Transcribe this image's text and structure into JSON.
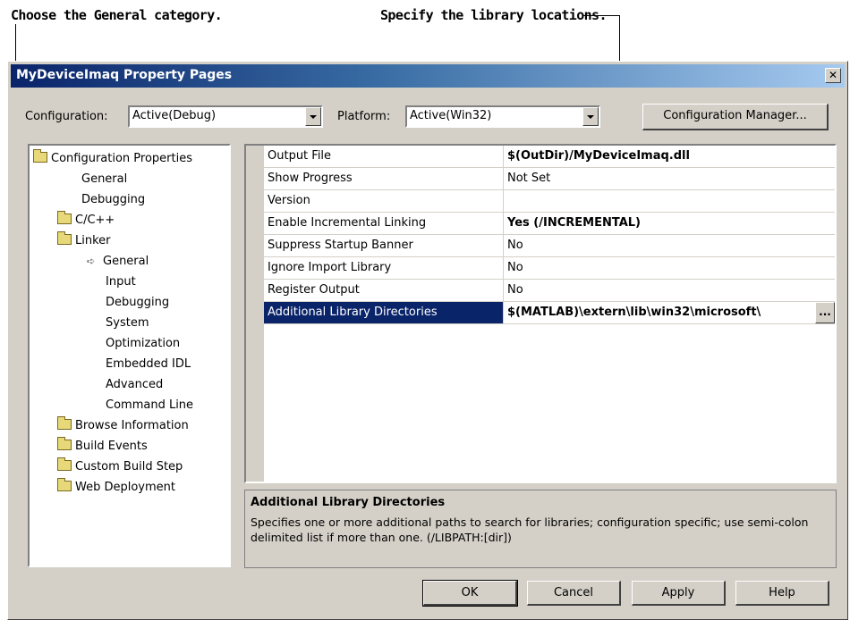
{
  "callouts": {
    "left": "Choose the General category.",
    "right": "Specify the library locations."
  },
  "window": {
    "title": "MyDeviceImaq Property Pages",
    "close_glyph": "✕"
  },
  "toolbar": {
    "configuration_label": "Configuration:",
    "configuration_value": "Active(Debug)",
    "platform_label": "Platform:",
    "platform_value": "Active(Win32)",
    "config_manager_label": "Configuration Manager..."
  },
  "tree": {
    "items": [
      {
        "label": "Configuration Properties",
        "icon": "folder-open-icon"
      },
      {
        "label": "General"
      },
      {
        "label": "Debugging"
      },
      {
        "label": "C/C++",
        "icon": "folder-icon"
      },
      {
        "label": "Linker",
        "icon": "folder-open-icon"
      },
      {
        "label": "General",
        "icon": "arrow-right-icon"
      },
      {
        "label": "Input"
      },
      {
        "label": "Debugging"
      },
      {
        "label": "System"
      },
      {
        "label": "Optimization"
      },
      {
        "label": "Embedded IDL"
      },
      {
        "label": "Advanced"
      },
      {
        "label": "Command Line"
      },
      {
        "label": "Browse Information",
        "icon": "folder-icon"
      },
      {
        "label": "Build Events",
        "icon": "folder-icon"
      },
      {
        "label": "Custom Build Step",
        "icon": "folder-icon"
      },
      {
        "label": "Web Deployment",
        "icon": "folder-icon"
      }
    ]
  },
  "properties": [
    {
      "name": "Output File",
      "value": "$(OutDir)/MyDeviceImaq.dll",
      "bold": true
    },
    {
      "name": "Show Progress",
      "value": "Not Set",
      "bold": false
    },
    {
      "name": "Version",
      "value": "",
      "bold": false
    },
    {
      "name": "Enable Incremental Linking",
      "value": "Yes (/INCREMENTAL)",
      "bold": true
    },
    {
      "name": "Suppress Startup Banner",
      "value": "No",
      "bold": false
    },
    {
      "name": "Ignore Import Library",
      "value": "No",
      "bold": false
    },
    {
      "name": "Register Output",
      "value": "No",
      "bold": false
    },
    {
      "name": "Additional Library Directories",
      "value": "$(MATLAB)\\extern\\lib\\win32\\microsoft\\",
      "bold": true,
      "selected": true
    }
  ],
  "ellipsis_label": "...",
  "description": {
    "title": "Additional Library Directories",
    "text": "Specifies one or more additional paths to search for libraries; configuration specific; use semi-colon delimited list if more than one.     (/LIBPATH:[dir])"
  },
  "buttons": {
    "ok": "OK",
    "cancel": "Cancel",
    "apply": "Apply",
    "help": "Help"
  },
  "colors": {
    "dialog_bg": "#d4d0c8",
    "title_gradient_start": "#0a246a",
    "title_gradient_end": "#a6caf0",
    "selection": "#0a246a"
  }
}
